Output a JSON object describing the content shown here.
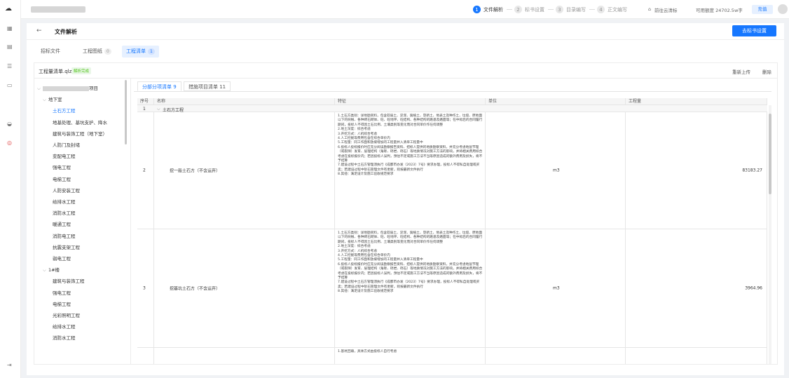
{
  "steps": [
    {
      "num": "1",
      "label": "文件解析",
      "active": true
    },
    {
      "num": "2",
      "label": "标书设置",
      "active": false
    },
    {
      "num": "3",
      "label": "目录编写",
      "active": false
    },
    {
      "num": "4",
      "label": "正文编写",
      "active": false
    }
  ],
  "topbar": {
    "cloud_link": "前往云清标",
    "balance": "可用额度 24702.5w字",
    "recharge": "充值"
  },
  "page": {
    "back": "←",
    "title": "文件解析",
    "primary_button": "去标书设置"
  },
  "file_tabs": [
    {
      "label": "招标文件",
      "count": "",
      "active": false
    },
    {
      "label": "工程图纸",
      "count": "0",
      "active": false
    },
    {
      "label": "工程清单",
      "count": "1",
      "active": true
    }
  ],
  "file": {
    "name": "工程量清单.qlz",
    "status": "解析完成",
    "reupload": "重新上传",
    "delete": "删除"
  },
  "tree": [
    {
      "label": "项目",
      "level": 0,
      "chev": "⌵",
      "blurred": true
    },
    {
      "label": "地下室",
      "level": 1,
      "chev": "⌵"
    },
    {
      "label": "土石方工程",
      "level": 2,
      "selected": true
    },
    {
      "label": "地基处理、基坑支护、降水",
      "level": 2
    },
    {
      "label": "建筑与装饰工程（地下室）",
      "level": 2
    },
    {
      "label": "人防门及封堵",
      "level": 2
    },
    {
      "label": "变配电工程",
      "level": 2
    },
    {
      "label": "强电工程",
      "level": 2
    },
    {
      "label": "电梯工程",
      "level": 2
    },
    {
      "label": "人防安装工程",
      "level": 2
    },
    {
      "label": "给排水工程",
      "level": 2
    },
    {
      "label": "消防水工程",
      "level": 2
    },
    {
      "label": "暖通工程",
      "level": 2
    },
    {
      "label": "消防电工程",
      "level": 2
    },
    {
      "label": "抗震支架工程",
      "level": 2
    },
    {
      "label": "弱电工程",
      "level": 2
    },
    {
      "label": "1#楼",
      "level": 1,
      "chev": "⌵"
    },
    {
      "label": "建筑与装饰工程",
      "level": 2
    },
    {
      "label": "强电工程",
      "level": 2
    },
    {
      "label": "电梯工程",
      "level": 2
    },
    {
      "label": "光彩照明工程",
      "level": 2
    },
    {
      "label": "给排水工程",
      "level": 2
    },
    {
      "label": "消防水工程",
      "level": 2
    }
  ],
  "content_tabs": [
    {
      "label": "分部分项清单 9",
      "active": true
    },
    {
      "label": "措施项目清单 11",
      "active": false
    }
  ],
  "table": {
    "headers": [
      "序号",
      "名称",
      "特征",
      "单位",
      "工程量"
    ],
    "group": {
      "no": "1",
      "name": "土石方工程"
    },
    "rows": [
      {
        "no": "2",
        "name": "挖一般土石方（不含运弃）",
        "feature": "1.土石方类别：详地勘资料，包含软弱土、淤泥、腐植土、垦新土、地表土及种作土、垃圾、原地面以下的树根、各种砖石砌体、砼、砼地坪、砼结构、各种结构的路基及路面等；在中标后的合同履行期间，投标人不得因土石比例、土壤类别等变化而对合同单价作任何调整\n2.地土深度：综合考虑\n3.开挖方式：人机综合考虑\n4.人工挖掘等费用包含在综合单价内\n5.工程量：同工作面和放坡增加的工程量并入清单工程量中\n6.投标人投标报价时应充分阅读勘察报告资料、招标人提供的地质勘察资料，并充分考虑地层节理（或裂隙）发育、层理结构（角砾、砾岩、砾石）等地质情况对施工方法的影响，并将相关费用综合考虑在投标报价内；若因投标人误判，预估不足或施工方法不当等原因造成的额外费用及损失，将不予结算\n7.建设过程中土石方管理须执行《成都市办发（2023）7号》要求办理，投标人不得私自处理或买卖；若建设过程中砂石管理文件有更新，则按最新文件执行\n8.其他：满足设计及施工验收规范要求",
        "unit": "m3",
        "qty": "83183.27"
      },
      {
        "no": "3",
        "name": "挖基坑土石方（不含运弃）",
        "feature": "1.土石方类别：详地勘资料，包含软弱土、淤泥、腐植土、垦新土、地表土及种作土、垃圾、原地面以下的树根、各种砖石砌体、砼、砼地坪、砼结构、各种结构的路基及路面等；在中标后的合同履行期间，投标人不得因土石比例、土壤类别等变化而对合同单价作任何调整\n2.地土深度：综合考虑\n3.开挖方式：人机综合考虑\n4.人工挖掘等费用包含在综合单价内\n5.工程量：同工作面和放坡增加的工程量并入清单工程量中\n6.投标人投标报价时应充分阅读勘察报告资料、招标人提供的地质勘察资料，并充分考虑地层节理（或裂隙）发育、层理结构（角砾、砾岩、砾石）等地质情况对施工方法的影响，并将相关费用综合考虑在投标报价内；若因投标人误判，预估不足或施工方法不当等原因造成的额外费用及损失，将不予结算\n7.建设过程中土石方管理须执行《成都市办发（2023）7号》要求办理，投标人不得私自处理或买卖；若建设过程中砂石管理文件有更新，则按最新文件执行\n8.其他：满足设计及施工验收规范要求",
        "unit": "m3",
        "qty": "3964.96"
      },
      {
        "no": "",
        "name": "",
        "feature": "1.基坑回填，具体方式由投标人自行考虑",
        "unit": "",
        "qty": ""
      }
    ]
  },
  "colors": {
    "accent": "#1677ff",
    "success": "#52c41a"
  }
}
